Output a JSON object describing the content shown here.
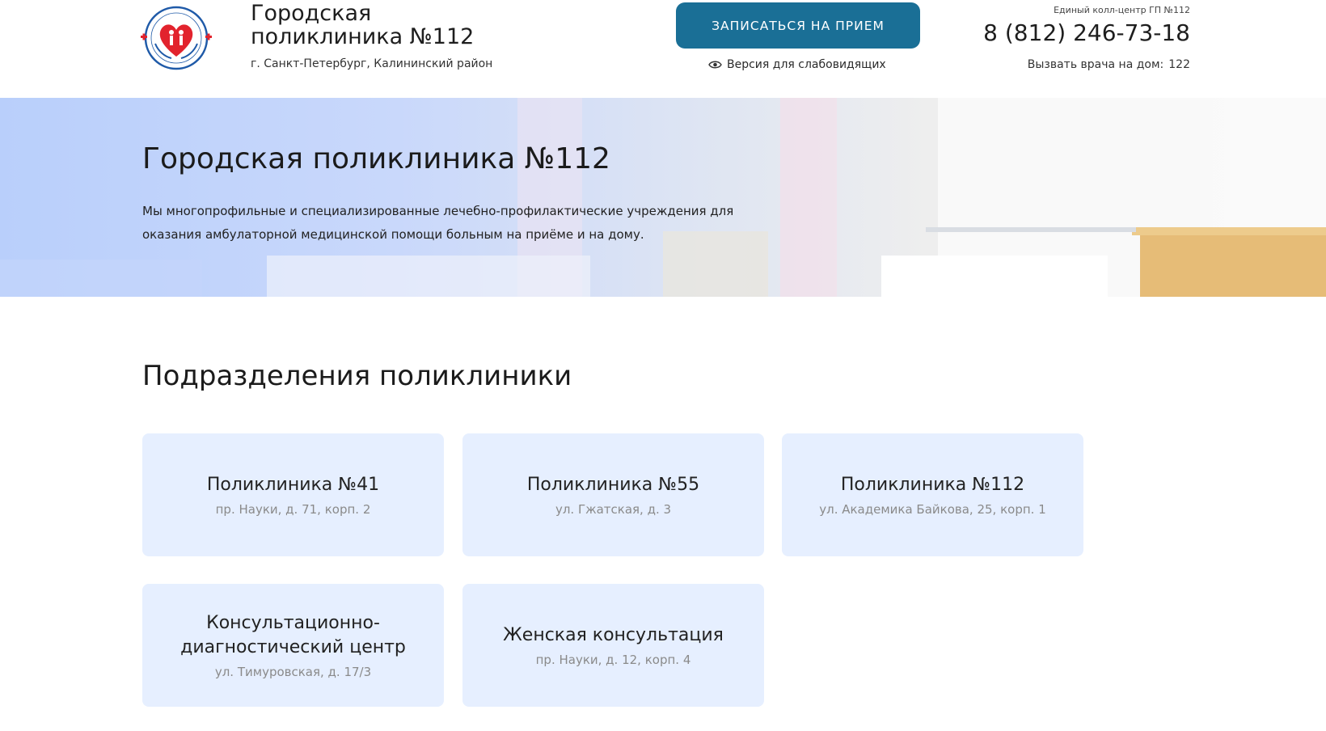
{
  "header": {
    "logo_icon": "clinic-logo-icon",
    "brand_title": "Городская\nполиклиника №112",
    "brand_subtitle": "г. Санкт-Петербург, Калининский район",
    "cta_label": "ЗАПИСАТЬСЯ НА ПРИЕМ",
    "accessibility_icon": "eye-icon",
    "accessibility_label": "Версия для слабовидящих",
    "call_center_label": "Единый колл-центр ГП №112",
    "phone": "8 (812) 246-73-18",
    "home_call_label": "Вызвать врача на дом:",
    "home_call_number": "122"
  },
  "hero": {
    "title": "Городская поликлиника №112",
    "text": "Мы многопрофильные и специализированные лечебно-профилактические учреждения для оказания амбулаторной медицинской помощи больным на приёме и на дому."
  },
  "divisions": {
    "title": "Подразделения поликлиники",
    "cards": [
      {
        "name": "Поликлиника №41",
        "address": "пр. Науки, д. 71, корп. 2"
      },
      {
        "name": "Поликлиника №55",
        "address": "ул. Гжатская, д. 3"
      },
      {
        "name": "Поликлиника №112",
        "address": "ул. Академика Байкова, 25, корп. 1"
      },
      {
        "name": "Консультационно-\nдиагностический центр",
        "address": "ул. Тимуровская, д. 17/3"
      },
      {
        "name": "Женская консультация",
        "address": "пр. Науки, д. 12, корп. 4"
      }
    ]
  },
  "colors": {
    "accent": "#1a6f96",
    "card_bg": "#e6efff",
    "hero_left": "#b9cffb",
    "logo_red": "#e2232d",
    "logo_blue": "#1f5aa8"
  }
}
